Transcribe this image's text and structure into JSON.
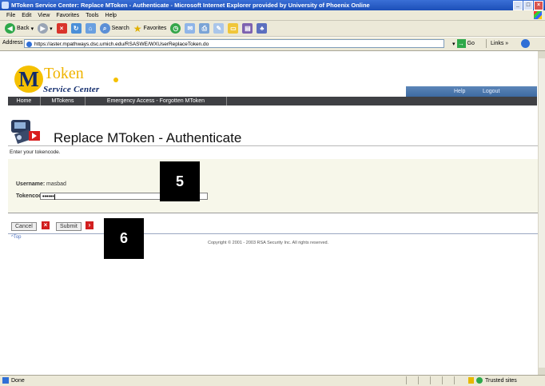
{
  "window": {
    "title": "MToken Service Center: Replace MToken - Authenticate - Microsoft Internet Explorer provided by University of Phoenix Online"
  },
  "menu": [
    "File",
    "Edit",
    "View",
    "Favorites",
    "Tools",
    "Help"
  ],
  "toolbar": {
    "back_label": "Back",
    "search_label": "Search",
    "favorites_label": "Favorites"
  },
  "address": {
    "label": "Address",
    "url": "https://aster.mpathways.dsc.umich.edu/RSASWE/WXUserReplaceToken.do",
    "go_label": "Go",
    "links_label": "Links"
  },
  "site": {
    "logo_letter": "M",
    "logo_token": "Token",
    "logo_subtitle": "Service Center",
    "nav": [
      "Home",
      "MTokens",
      "Emergency Access - Forgotten MToken"
    ],
    "top_links": [
      "Help",
      "Logout"
    ]
  },
  "page": {
    "title": "Replace MToken - Authenticate",
    "instruction": "Enter your tokencode.",
    "username_label": "Username:",
    "username_value": "masbad",
    "tokencode_label": "Tokencode:",
    "tokencode_value": "••••••",
    "cancel_label": "Cancel",
    "submit_label": "Submit",
    "top_link": "^Top",
    "copyright": "Copyright © 2001 - 2003 RSA Security Inc. All rights reserved."
  },
  "callouts": [
    "5",
    "6"
  ],
  "status": {
    "left": "Done",
    "zone": "Trusted sites"
  },
  "colors": {
    "titlebar": "#2a5fcf",
    "nav_dark": "#3f4044",
    "nav_blue": "#4a76ad",
    "logo_gold": "#f5c000",
    "logo_navy": "#102a6b",
    "button_icon": "#d21f1f"
  }
}
